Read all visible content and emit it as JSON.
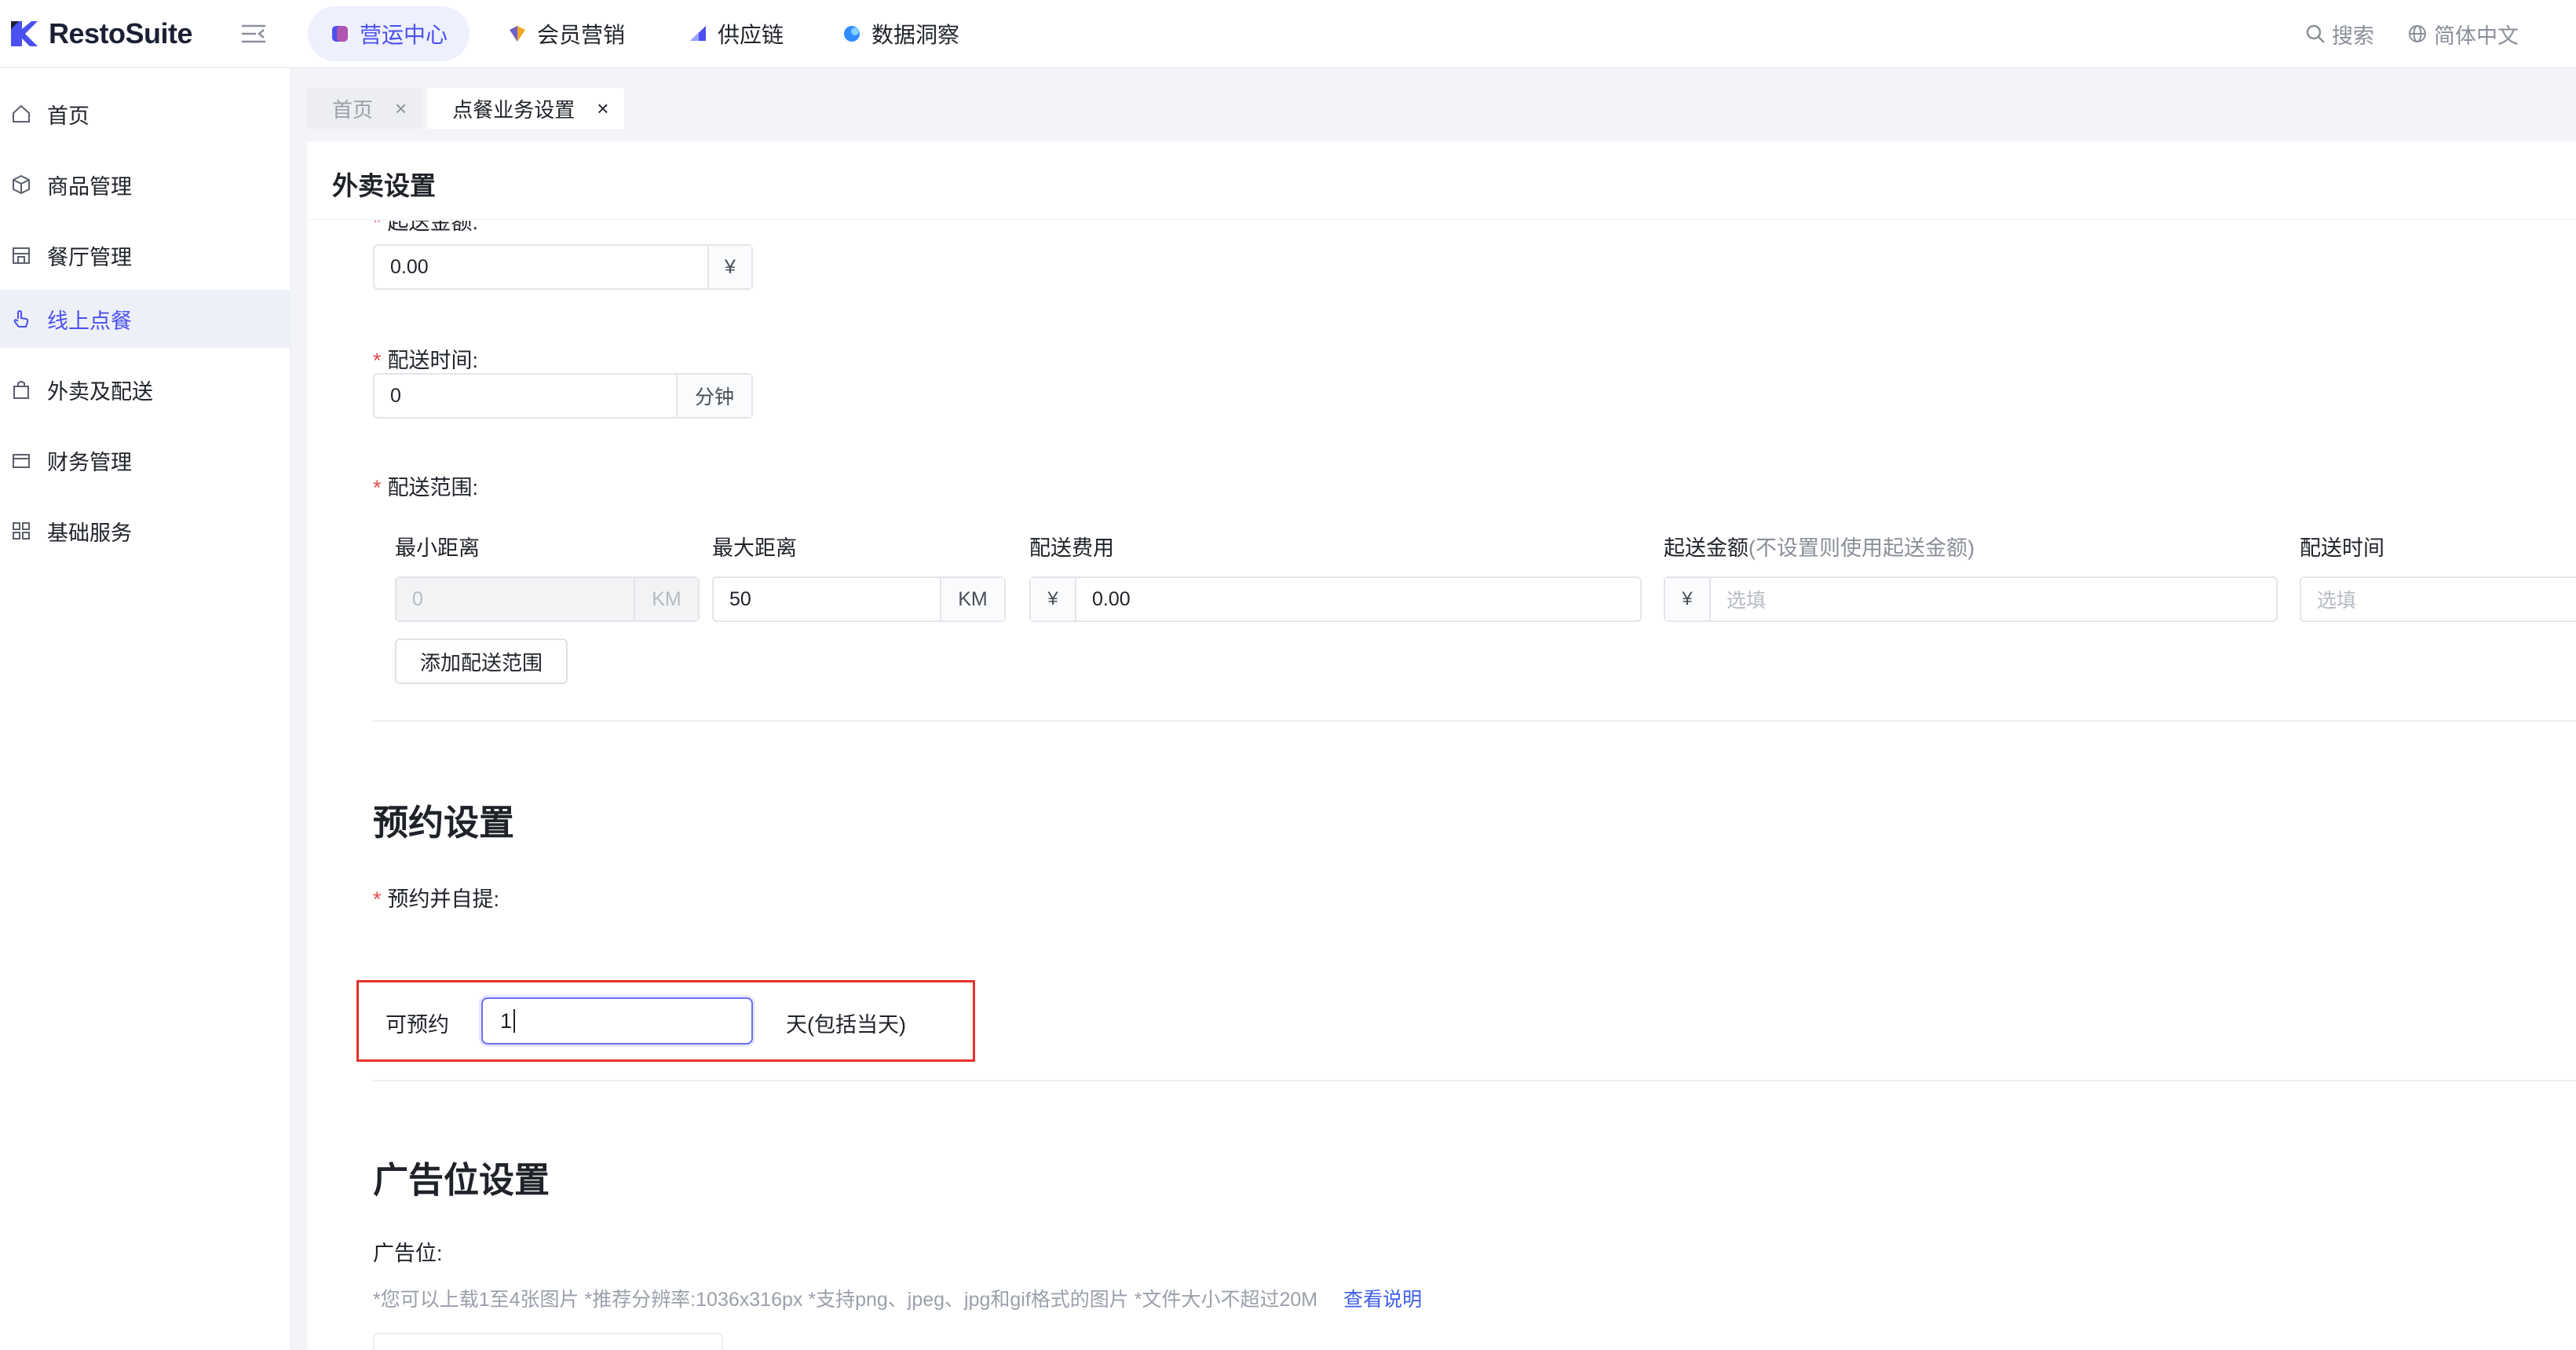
{
  "app": {
    "name": "RestoSuite"
  },
  "topnav": {
    "items": [
      {
        "label": "营运中心",
        "active": true,
        "color": "#4b50f0"
      },
      {
        "label": "会员营销",
        "active": false,
        "color": "#f5a623"
      },
      {
        "label": "供应链",
        "active": false,
        "color": "#4b50f0"
      },
      {
        "label": "数据洞察",
        "active": false,
        "color": "#2f8cff"
      }
    ],
    "search_label": "搜索",
    "language_label": "简体中文"
  },
  "sidebar": {
    "items": [
      {
        "label": "首页",
        "icon": "home-icon"
      },
      {
        "label": "商品管理",
        "icon": "box-icon"
      },
      {
        "label": "餐厅管理",
        "icon": "store-icon"
      },
      {
        "label": "线上点餐",
        "icon": "hand-icon",
        "active": true
      },
      {
        "label": "外卖及配送",
        "icon": "bag-icon"
      },
      {
        "label": "财务管理",
        "icon": "wallet-icon"
      },
      {
        "label": "基础服务",
        "icon": "grid-icon"
      }
    ]
  },
  "tabs": [
    {
      "label": "首页",
      "close": "×",
      "active": false
    },
    {
      "label": "点餐业务设置",
      "close": "×",
      "active": true
    }
  ],
  "page": {
    "title": "外卖设置",
    "min_delivery_amount": {
      "label": "起送金额:",
      "value": "0.00",
      "unit": "¥"
    },
    "delivery_time": {
      "label": "配送时间:",
      "value": "0",
      "unit": "分钟"
    },
    "delivery_range": {
      "label": "配送范围:",
      "columns": {
        "min_distance": "最小距离",
        "max_distance": "最大距离",
        "fee": "配送费用",
        "min_amount": "起送金额",
        "min_amount_note": "(不设置则使用起送金额)",
        "time": "配送时间"
      },
      "row": {
        "min_distance": "0",
        "min_distance_unit": "KM",
        "max_distance": "50",
        "max_distance_unit": "KM",
        "fee_currency": "¥",
        "fee": "0.00",
        "min_amount_currency": "¥",
        "min_amount_placeholder": "选填",
        "time_placeholder": "选填"
      },
      "add_button": "添加配送范围"
    },
    "reservation": {
      "title": "预约设置",
      "pickup_label": "预约并自提:",
      "prefix": "可预约",
      "days_value": "1",
      "suffix": "天(包括当天)"
    },
    "ads": {
      "title": "广告位设置",
      "label": "广告位:",
      "hint": "*您可以上载1至4张图片 *推荐分辨率:1036x316px *支持png、jpeg、jpg和gif格式的图片 *文件大小不超过20M",
      "link": "查看说明"
    }
  }
}
